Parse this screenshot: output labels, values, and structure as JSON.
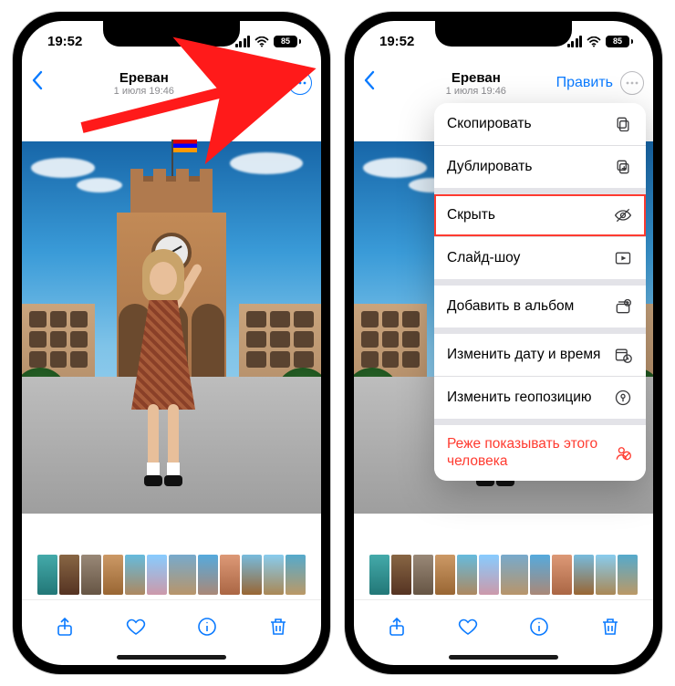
{
  "status": {
    "time": "19:52",
    "battery": "85"
  },
  "nav": {
    "title": "Ереван",
    "subtitle": "1 июля 19:46",
    "edit": "Править"
  },
  "menu": {
    "copy": "Скопировать",
    "duplicate": "Дублировать",
    "hide": "Скрыть",
    "slideshow": "Слайд-шоу",
    "add_to_album": "Добавить в альбом",
    "adjust_datetime": "Изменить дату и время",
    "adjust_location": "Изменить геопозицию",
    "feature_less": "Реже показывать этого человека"
  }
}
